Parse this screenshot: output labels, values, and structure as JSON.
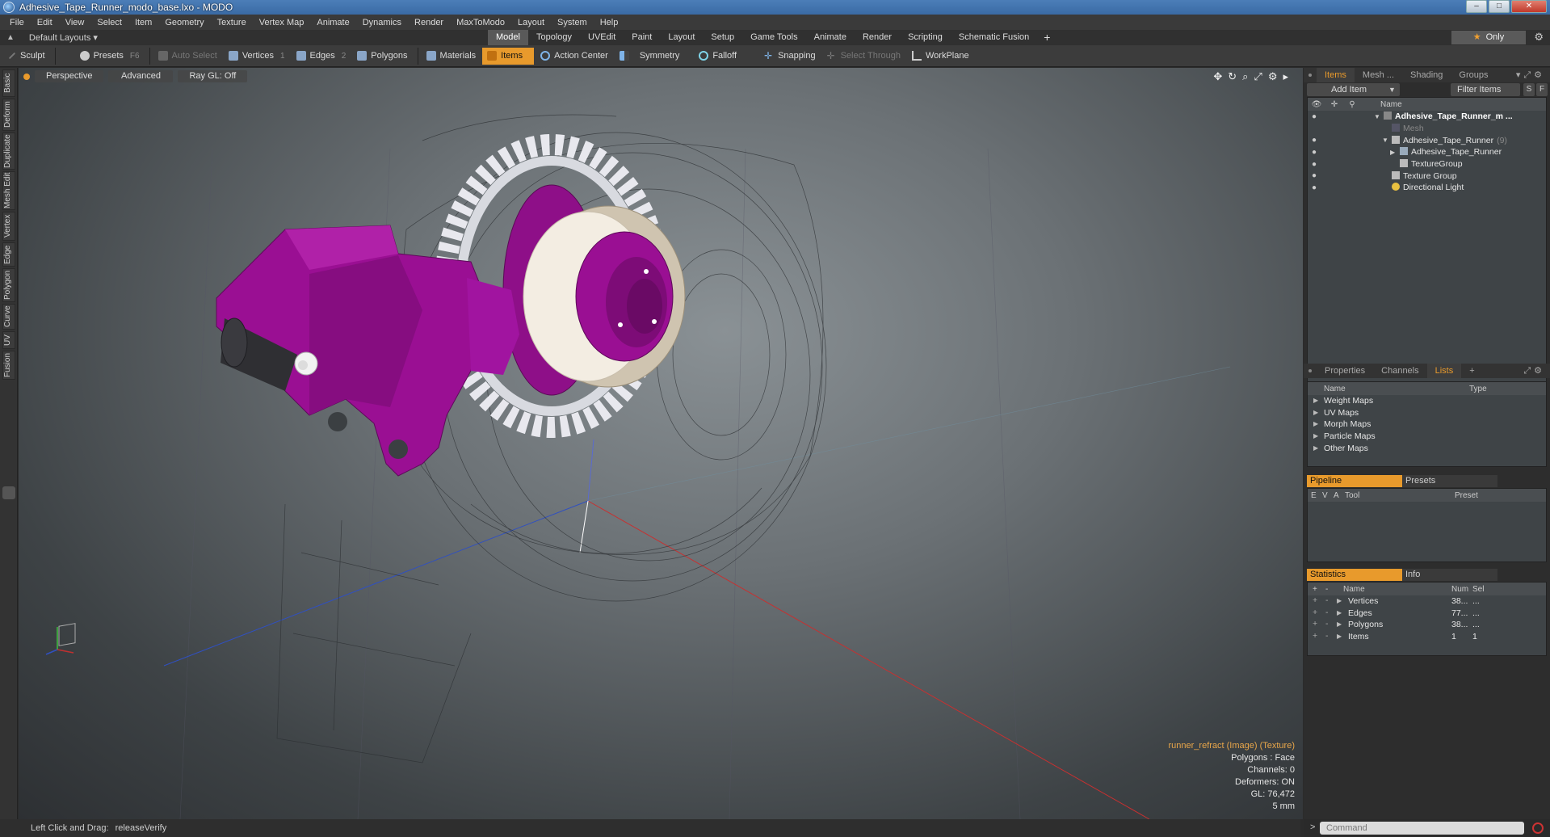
{
  "window": {
    "title": "Adhesive_Tape_Runner_modo_base.lxo - MODO",
    "buttons": [
      "–",
      "□",
      "✕"
    ]
  },
  "menu": [
    "File",
    "Edit",
    "View",
    "Select",
    "Item",
    "Geometry",
    "Texture",
    "Vertex Map",
    "Animate",
    "Dynamics",
    "Render",
    "MaxToModo",
    "Layout",
    "System",
    "Help"
  ],
  "layoutbar": {
    "layouts_label": "Default Layouts",
    "tabs": [
      "Model",
      "Topology",
      "UVEdit",
      "Paint",
      "Layout",
      "Setup",
      "Game Tools",
      "Animate",
      "Render",
      "Scripting",
      "Schematic Fusion"
    ],
    "active_tab": "Model",
    "only_label": "Only"
  },
  "toolbar": {
    "sculpt": "Sculpt",
    "presets": "Presets",
    "presets_key": "F6",
    "auto_select": "Auto Select",
    "vertices": "Vertices",
    "vertices_key": "1",
    "edges": "Edges",
    "edges_key": "2",
    "polygons": "Polygons",
    "materials": "Materials",
    "items": "Items",
    "action_center": "Action Center",
    "symmetry": "Symmetry",
    "falloff": "Falloff",
    "snapping": "Snapping",
    "select_through": "Select Through",
    "workplane": "WorkPlane"
  },
  "lefttabs": [
    "Basic",
    "Deform",
    "Duplicate",
    "Mesh Edit",
    "Vertex",
    "Edge",
    "Polygon",
    "Curve",
    "UV",
    "Fusion"
  ],
  "viewport": {
    "view": "Perspective",
    "shading": "Advanced",
    "raygl": "Ray GL: Off",
    "info": {
      "texture": "runner_refract (Image) (Texture)",
      "polygons": "Polygons : Face",
      "channels": "Channels: 0",
      "deformers": "Deformers: ON",
      "gl": "GL: 76,472",
      "scale": "5 mm"
    }
  },
  "statusbar": {
    "label": "Left Click and Drag:",
    "value": "releaseVerify"
  },
  "items_panel": {
    "tabs": [
      "Items",
      "Mesh ...",
      "Shading",
      "Groups"
    ],
    "active_tab": "Items",
    "add_item": "Add Item",
    "filter_items": "Filter Items",
    "s": "S",
    "f": "F",
    "name_header": "Name",
    "tree": [
      {
        "label": "Adhesive_Tape_Runner_m ...",
        "bold": true
      },
      {
        "label": "Mesh",
        "dim": true
      },
      {
        "label": "Adhesive_Tape_Runner",
        "count": "(9)"
      },
      {
        "label": "Adhesive_Tape_Runner"
      },
      {
        "label": "TextureGroup"
      },
      {
        "label": "Texture Group"
      },
      {
        "label": "Directional Light"
      }
    ]
  },
  "props_panel": {
    "tabs": [
      "Properties",
      "Channels",
      "Lists"
    ],
    "active_tab": "Lists",
    "name_header": "Name",
    "type_header": "Type",
    "lists": [
      "Weight Maps",
      "UV Maps",
      "Morph Maps",
      "Particle Maps",
      "Other Maps"
    ]
  },
  "pipeline_panel": {
    "tabs": [
      "Pipeline",
      "Presets"
    ],
    "active_tab": "Pipeline",
    "headers": [
      "E",
      "V",
      "A",
      "Tool",
      "Preset"
    ]
  },
  "stats_panel": {
    "tabs": [
      "Statistics",
      "Info"
    ],
    "active_tab": "Statistics",
    "headers": [
      "+",
      "-",
      "Name",
      "Num",
      "Sel"
    ],
    "rows": [
      {
        "name": "Vertices",
        "num": "38...",
        "sel": "..."
      },
      {
        "name": "Edges",
        "num": "77...",
        "sel": "..."
      },
      {
        "name": "Polygons",
        "num": "38...",
        "sel": "..."
      },
      {
        "name": "Items",
        "num": "1",
        "sel": "1"
      }
    ]
  },
  "command": {
    "placeholder": "Command"
  },
  "colors": {
    "accent": "#e89a2c",
    "magenta": "#9a0f93"
  }
}
